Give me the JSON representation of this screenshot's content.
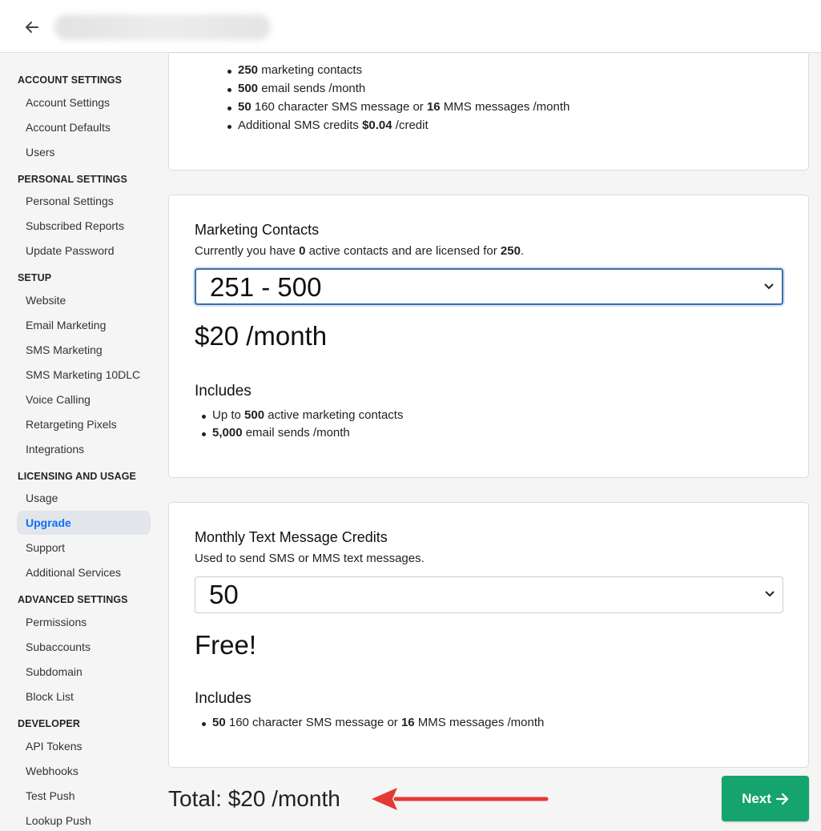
{
  "sidebar": {
    "sections": [
      {
        "title": "ACCOUNT SETTINGS",
        "items": [
          "Account Settings",
          "Account Defaults",
          "Users"
        ]
      },
      {
        "title": "PERSONAL SETTINGS",
        "items": [
          "Personal Settings",
          "Subscribed Reports",
          "Update Password"
        ]
      },
      {
        "title": "SETUP",
        "items": [
          "Website",
          "Email Marketing",
          "SMS Marketing",
          "SMS Marketing 10DLC",
          "Voice Calling",
          "Retargeting Pixels",
          "Integrations"
        ]
      },
      {
        "title": "LICENSING AND USAGE",
        "items": [
          "Usage",
          "Upgrade",
          "Support",
          "Additional Services"
        ]
      },
      {
        "title": "ADVANCED SETTINGS",
        "items": [
          "Permissions",
          "Subaccounts",
          "Subdomain",
          "Block List"
        ]
      },
      {
        "title": "DEVELOPER",
        "items": [
          "API Tokens",
          "Webhooks",
          "Test Push",
          "Lookup Push"
        ]
      }
    ],
    "active_item": "Upgrade"
  },
  "top_card": {
    "bullets": [
      {
        "bold": "250",
        "text": " marketing contacts"
      },
      {
        "bold": "500",
        "text": " email sends /month"
      },
      {
        "bold": "50",
        "text": " 160 character SMS message or ",
        "bold2": "16",
        "text2": " MMS messages /month"
      },
      {
        "pre": "Additional SMS credits ",
        "bold": "$0.04",
        "text": " /credit"
      }
    ]
  },
  "contacts_card": {
    "title": "Marketing Contacts",
    "sub_pre": "Currently you have ",
    "sub_active": "0",
    "sub_mid": " active contacts and are licensed for ",
    "sub_licensed": "250",
    "sub_end": ".",
    "selected": "251 - 500",
    "price": "$20 /month",
    "includes_title": "Includes",
    "bullets": [
      {
        "pre": "Up to ",
        "bold": "500",
        "text": " active marketing contacts"
      },
      {
        "bold": "5,000",
        "text": " email sends /month"
      }
    ]
  },
  "sms_card": {
    "title": "Monthly Text Message Credits",
    "sub": "Used to send SMS or MMS text messages.",
    "selected": "50",
    "price": "Free!",
    "includes_title": "Includes",
    "bullets": [
      {
        "bold": "50",
        "text": " 160 character SMS message or ",
        "bold2": "16",
        "text2": " MMS messages /month"
      }
    ]
  },
  "footer": {
    "total": "Total: $20 /month",
    "next_label": "Next",
    "arrow_color": "#e53935",
    "next_color": "#16a46e"
  },
  "icons": {
    "back": "arrow-left-icon",
    "chevron": "chevron-down-icon",
    "next": "arrow-right-icon"
  }
}
